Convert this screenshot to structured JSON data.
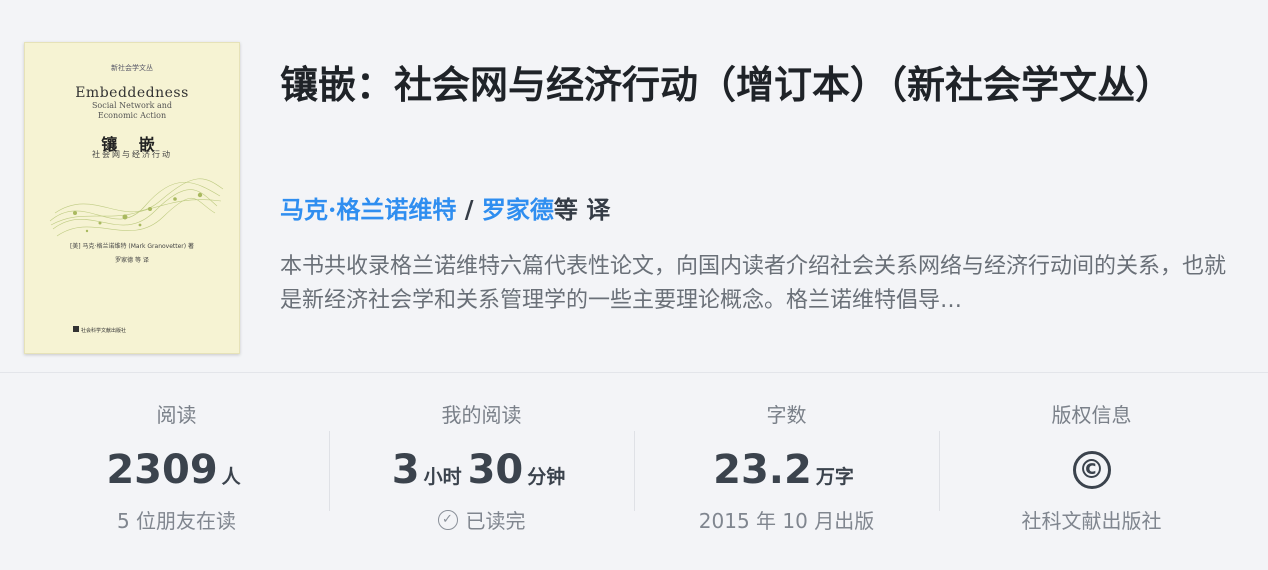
{
  "cover": {
    "series": "新社会学文丛",
    "en_title": "Embeddedness",
    "en_subtitle": "Social Network and\nEconomic Action",
    "zh_title": "镶 嵌",
    "zh_subtitle": "社会网与经济行动",
    "author": "[美] 马克·格兰诺维特 (Mark Granovetter) 著",
    "translator": "罗家德 等 译",
    "publisher": "社会科学文献出版社"
  },
  "book": {
    "title": "镶嵌：社会网与经济行动（增订本）（新社会学文丛）",
    "author": "马克·格兰诺维特",
    "separator": "/",
    "translator": "罗家德",
    "translator_suffix": "等 译",
    "description": "本书共收录格兰诺维特六篇代表性论文，向国内读者介绍社会关系网络与经济行动间的关系，也就是新经济社会学和关系管理学的一些主要理论概念。格兰诺维特倡导…"
  },
  "stats": {
    "reading": {
      "label": "阅读",
      "value": "2309",
      "unit": "人",
      "sub": "5 位朋友在读"
    },
    "my_reading": {
      "label": "我的阅读",
      "hours": "3",
      "hours_unit": "小时",
      "minutes": "30",
      "minutes_unit": "分钟",
      "sub": "已读完",
      "icon": "check-circle-icon"
    },
    "words": {
      "label": "字数",
      "value": "23.2",
      "unit": "万字",
      "sub": "2015 年 10 月出版"
    },
    "copyright": {
      "label": "版权信息",
      "icon": "copyright-icon",
      "symbol": "©",
      "sub": "社科文献出版社"
    }
  },
  "colors": {
    "link": "#2f8ef0",
    "background": "#f3f4f7",
    "title": "#1f2328"
  }
}
